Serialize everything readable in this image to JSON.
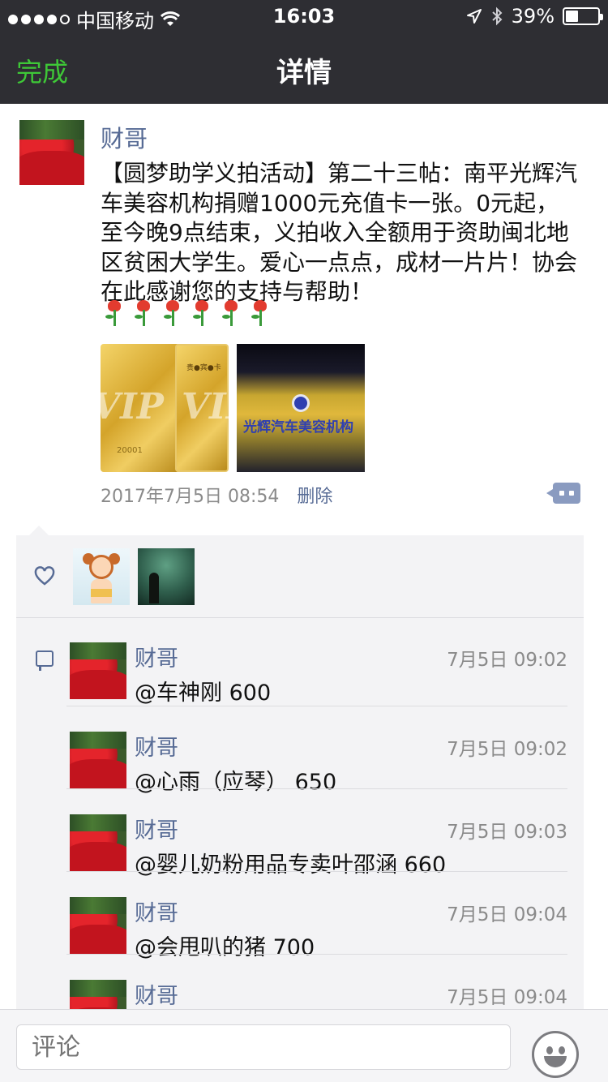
{
  "status_bar": {
    "carrier": "中国移动",
    "time": "16:03",
    "battery": "39%",
    "battery_level": 0.39
  },
  "nav": {
    "done_label": "完成",
    "title": "详情"
  },
  "post": {
    "username": "财哥",
    "text": "【圆梦助学义拍活动】第二十三帖：南平光辉汽车美容机构捐赠1000元充值卡一张。0元起，至今晚9点结束，义拍收入全额用于资助闽北地区贫困大学生。爱心一点点，成材一片片！协会在此感谢您的支持与帮助！",
    "rose_count": 6,
    "photo_texts": {
      "card_top": "贵●宾●卡",
      "card_vip": "VIP",
      "card_num": "20001",
      "sign": "光辉汽车美容机构"
    },
    "timestamp": "2017年7月5日 08:54",
    "delete_label": "删除"
  },
  "likes": {
    "count": 2
  },
  "comments": [
    {
      "name": "财哥",
      "time": "7月5日 09:02",
      "text": "@车神刚 600"
    },
    {
      "name": "财哥",
      "time": "7月5日 09:02",
      "text": "@心雨（应琴） 650"
    },
    {
      "name": "财哥",
      "time": "7月5日 09:03",
      "text": "@婴儿奶粉用品专卖叶邵涵 660"
    },
    {
      "name": "财哥",
      "time": "7月5日 09:04",
      "text": "@会甩叭的猪 700"
    },
    {
      "name": "财哥",
      "time": "7月5日 09:04",
      "text": ""
    }
  ],
  "input": {
    "placeholder": "评论"
  },
  "colors": {
    "nav_bg": "#2e2e33",
    "done_green": "#3ec837",
    "link_blue": "#576b95",
    "panel_bg": "#f3f3f5"
  }
}
